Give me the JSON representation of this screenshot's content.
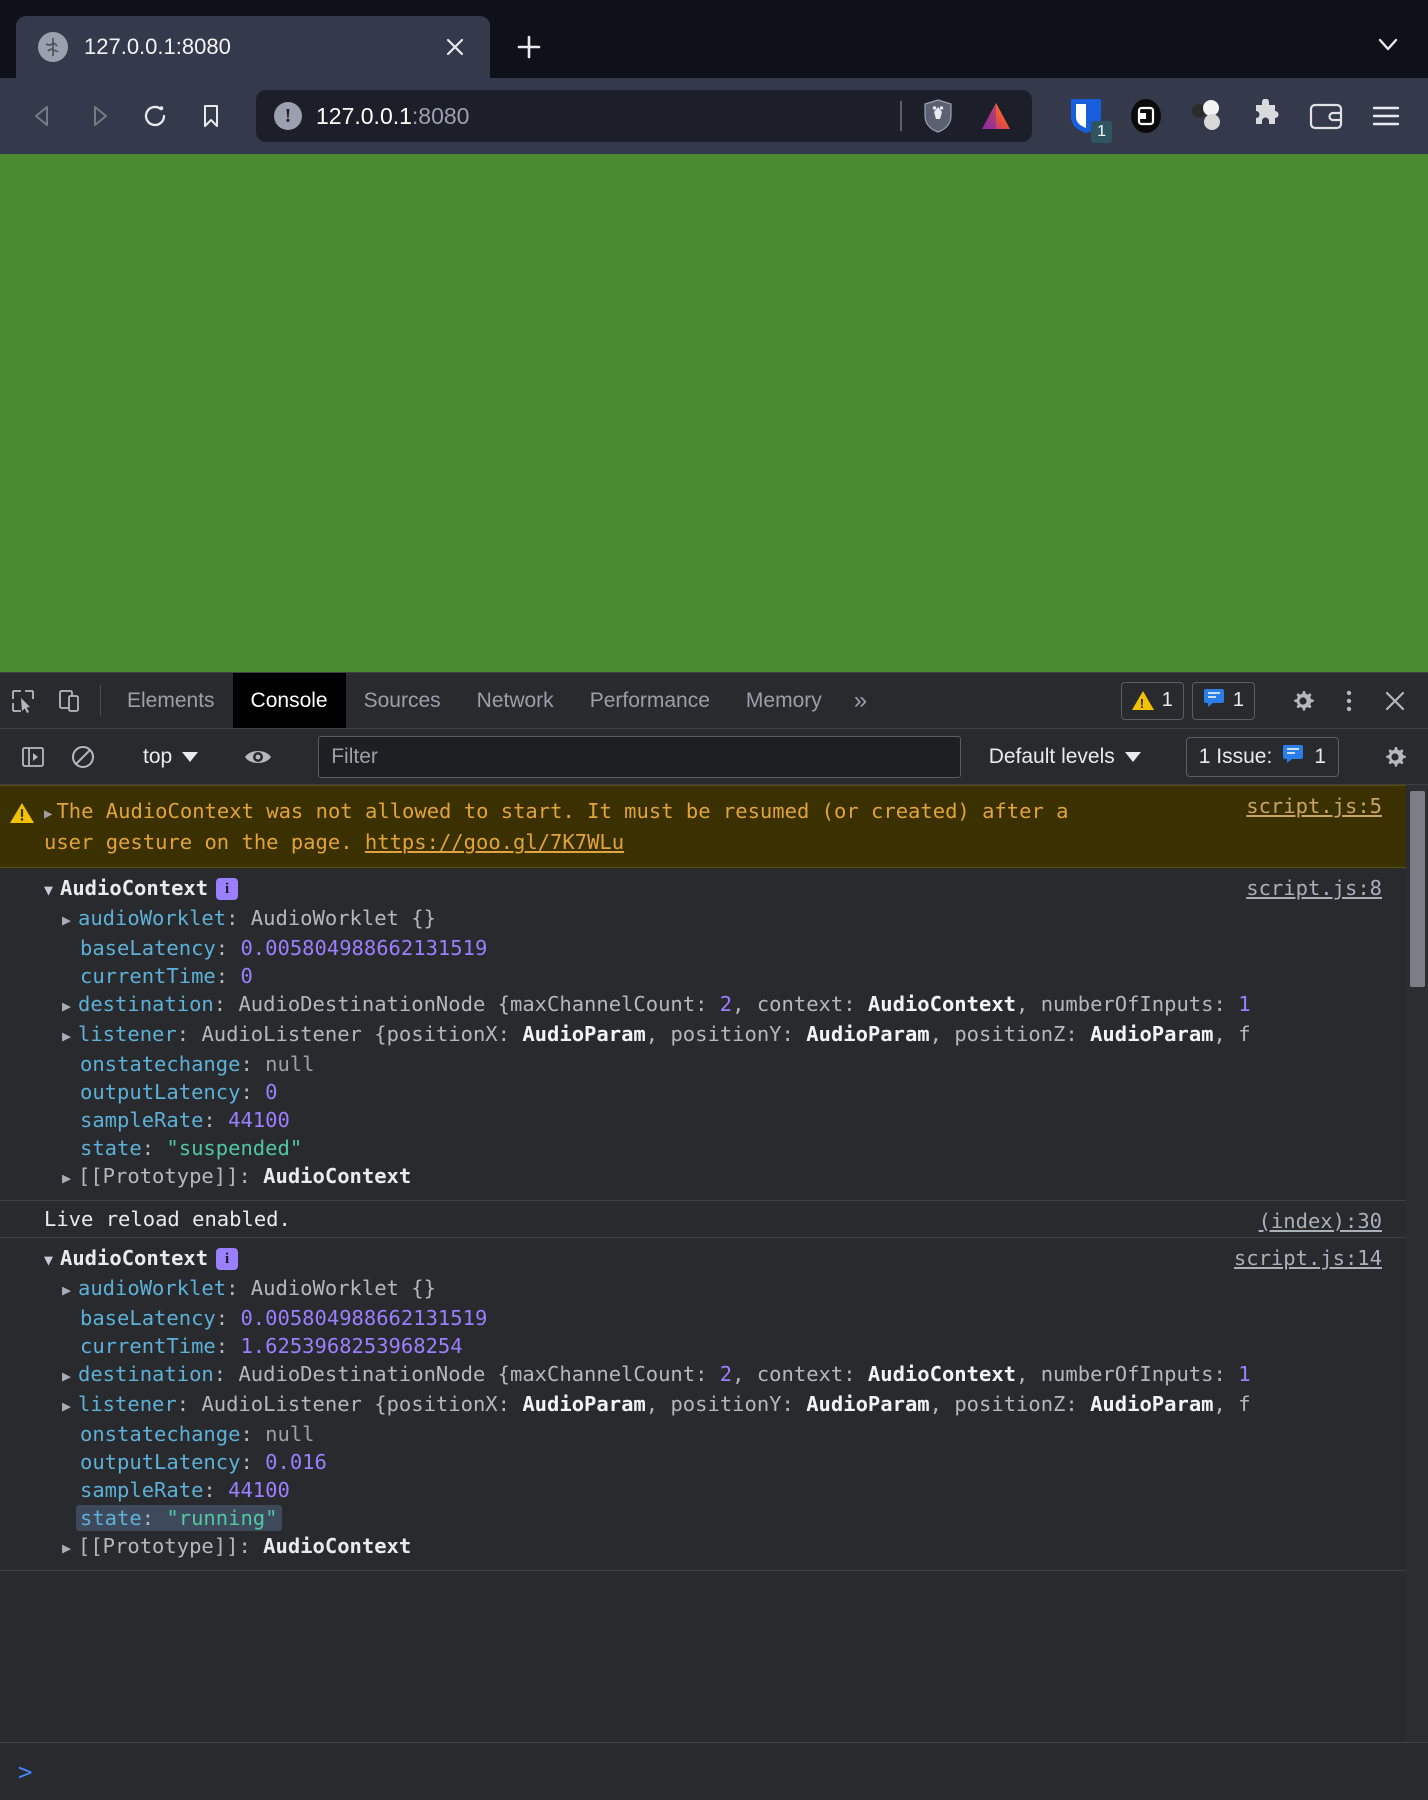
{
  "browser": {
    "tab": {
      "title": "127.0.0.1:8080",
      "favicon_icon": "globe-icon",
      "close_icon": "close-icon"
    },
    "new_tab_label": "+",
    "tab_list_chevron_icon": "chevron-down-icon",
    "nav": {
      "back_icon": "back-arrow-icon",
      "forward_icon": "forward-arrow-icon",
      "reload_icon": "reload-icon",
      "bookmark_icon": "bookmark-icon"
    },
    "omnibox": {
      "security_icon": "info-circle-icon",
      "url_host": "127.0.0.1",
      "url_port": ":8080",
      "shields_icon": "brave-shields-lion-icon",
      "rewards_icon": "brave-rewards-triangle-icon"
    },
    "extensions": [
      {
        "name": "bitwarden-extension-icon",
        "badge": "1"
      },
      {
        "name": "extension-dark-icon",
        "badge": ""
      },
      {
        "name": "molecule-extension-icon",
        "badge": ""
      },
      {
        "name": "puzzle-extensions-icon",
        "badge": ""
      },
      {
        "name": "wallet-icon",
        "badge": ""
      },
      {
        "name": "menu-hamburger-icon",
        "badge": ""
      }
    ]
  },
  "viewport": {
    "background_color": "#4a8b31"
  },
  "devtools": {
    "toolbar_icons": {
      "inspect": "inspect-element-icon",
      "device": "device-toolbar-icon"
    },
    "tabs": [
      {
        "label": "Elements",
        "active": false
      },
      {
        "label": "Console",
        "active": true
      },
      {
        "label": "Sources",
        "active": false
      },
      {
        "label": "Network",
        "active": false
      },
      {
        "label": "Performance",
        "active": false
      },
      {
        "label": "Memory",
        "active": false
      }
    ],
    "more_tabs_label": "»",
    "warning_count": "1",
    "message_count": "1",
    "settings_icon": "gear-icon",
    "more_options_icon": "kebab-menu-icon",
    "close_icon": "close-icon",
    "console_toolbar": {
      "sidebar_icon": "console-sidebar-icon",
      "clear_icon": "clear-console-icon",
      "context": "top",
      "eye_icon": "live-expression-eye-icon",
      "filter_placeholder": "Filter",
      "filter_value": "",
      "levels_label": "Default levels",
      "issues_label": "1 Issue:",
      "issues_count": "1",
      "settings_icon": "console-settings-gear-icon"
    }
  },
  "console": {
    "warning": {
      "icon": "warning-triangle-icon",
      "text_part1": "The AudioContext was not allowed to start. It must be resumed (or created) after a",
      "text_part2": "user gesture on the page.",
      "link": "https://goo.gl/7K7WLu",
      "source": "script.js:5"
    },
    "entry1": {
      "source": "script.js:8",
      "class_name": "AudioContext",
      "info_badge": "i",
      "props": [
        {
          "indent": 1,
          "arrow": "collapsed",
          "name": "audioWorklet",
          "value": "AudioWorklet {}",
          "type": "object"
        },
        {
          "indent": 1,
          "arrow": "none",
          "name": "baseLatency",
          "value": "0.005804988662131519",
          "type": "number"
        },
        {
          "indent": 1,
          "arrow": "none",
          "name": "currentTime",
          "value": "0",
          "type": "number"
        },
        {
          "indent": 1,
          "arrow": "collapsed",
          "name": "destination",
          "value": "AudioDestinationNode {maxChannelCount: 2, context: AudioContext, numberOfInputs: 1",
          "type": "preview-destination"
        },
        {
          "indent": 1,
          "arrow": "collapsed",
          "name": "listener",
          "value": "AudioListener {positionX: AudioParam, positionY: AudioParam, positionZ: AudioParam, f",
          "type": "preview-listener"
        },
        {
          "indent": 1,
          "arrow": "none",
          "name": "onstatechange",
          "value": "null",
          "type": "null"
        },
        {
          "indent": 1,
          "arrow": "none",
          "name": "outputLatency",
          "value": "0",
          "type": "number"
        },
        {
          "indent": 1,
          "arrow": "none",
          "name": "sampleRate",
          "value": "44100",
          "type": "number"
        },
        {
          "indent": 1,
          "arrow": "none",
          "name": "state",
          "value": "\"suspended\"",
          "type": "string"
        },
        {
          "indent": 1,
          "arrow": "collapsed",
          "name": "[[Prototype]]",
          "value": "AudioContext",
          "type": "proto"
        }
      ]
    },
    "entry2": {
      "text": "Live reload enabled.",
      "source": "(index):30"
    },
    "entry3": {
      "source": "script.js:14",
      "class_name": "AudioContext",
      "info_badge": "i",
      "props": [
        {
          "indent": 1,
          "arrow": "collapsed",
          "name": "audioWorklet",
          "value": "AudioWorklet {}",
          "type": "object"
        },
        {
          "indent": 1,
          "arrow": "none",
          "name": "baseLatency",
          "value": "0.005804988662131519",
          "type": "number"
        },
        {
          "indent": 1,
          "arrow": "none",
          "name": "currentTime",
          "value": "1.6253968253968254",
          "type": "number"
        },
        {
          "indent": 1,
          "arrow": "collapsed",
          "name": "destination",
          "value": "AudioDestinationNode {maxChannelCount: 2, context: AudioContext, numberOfInputs: 1",
          "type": "preview-destination"
        },
        {
          "indent": 1,
          "arrow": "collapsed",
          "name": "listener",
          "value": "AudioListener {positionX: AudioParam, positionY: AudioParam, positionZ: AudioParam, f",
          "type": "preview-listener"
        },
        {
          "indent": 1,
          "arrow": "none",
          "name": "onstatechange",
          "value": "null",
          "type": "null"
        },
        {
          "indent": 1,
          "arrow": "none",
          "name": "outputLatency",
          "value": "0.016",
          "type": "number"
        },
        {
          "indent": 1,
          "arrow": "none",
          "name": "sampleRate",
          "value": "44100",
          "type": "number"
        },
        {
          "indent": 1,
          "arrow": "none",
          "name": "state",
          "value": "\"running\"",
          "type": "string",
          "highlighted": true
        },
        {
          "indent": 1,
          "arrow": "collapsed",
          "name": "[[Prototype]]",
          "value": "AudioContext",
          "type": "proto"
        }
      ]
    },
    "prompt_caret": ">"
  }
}
